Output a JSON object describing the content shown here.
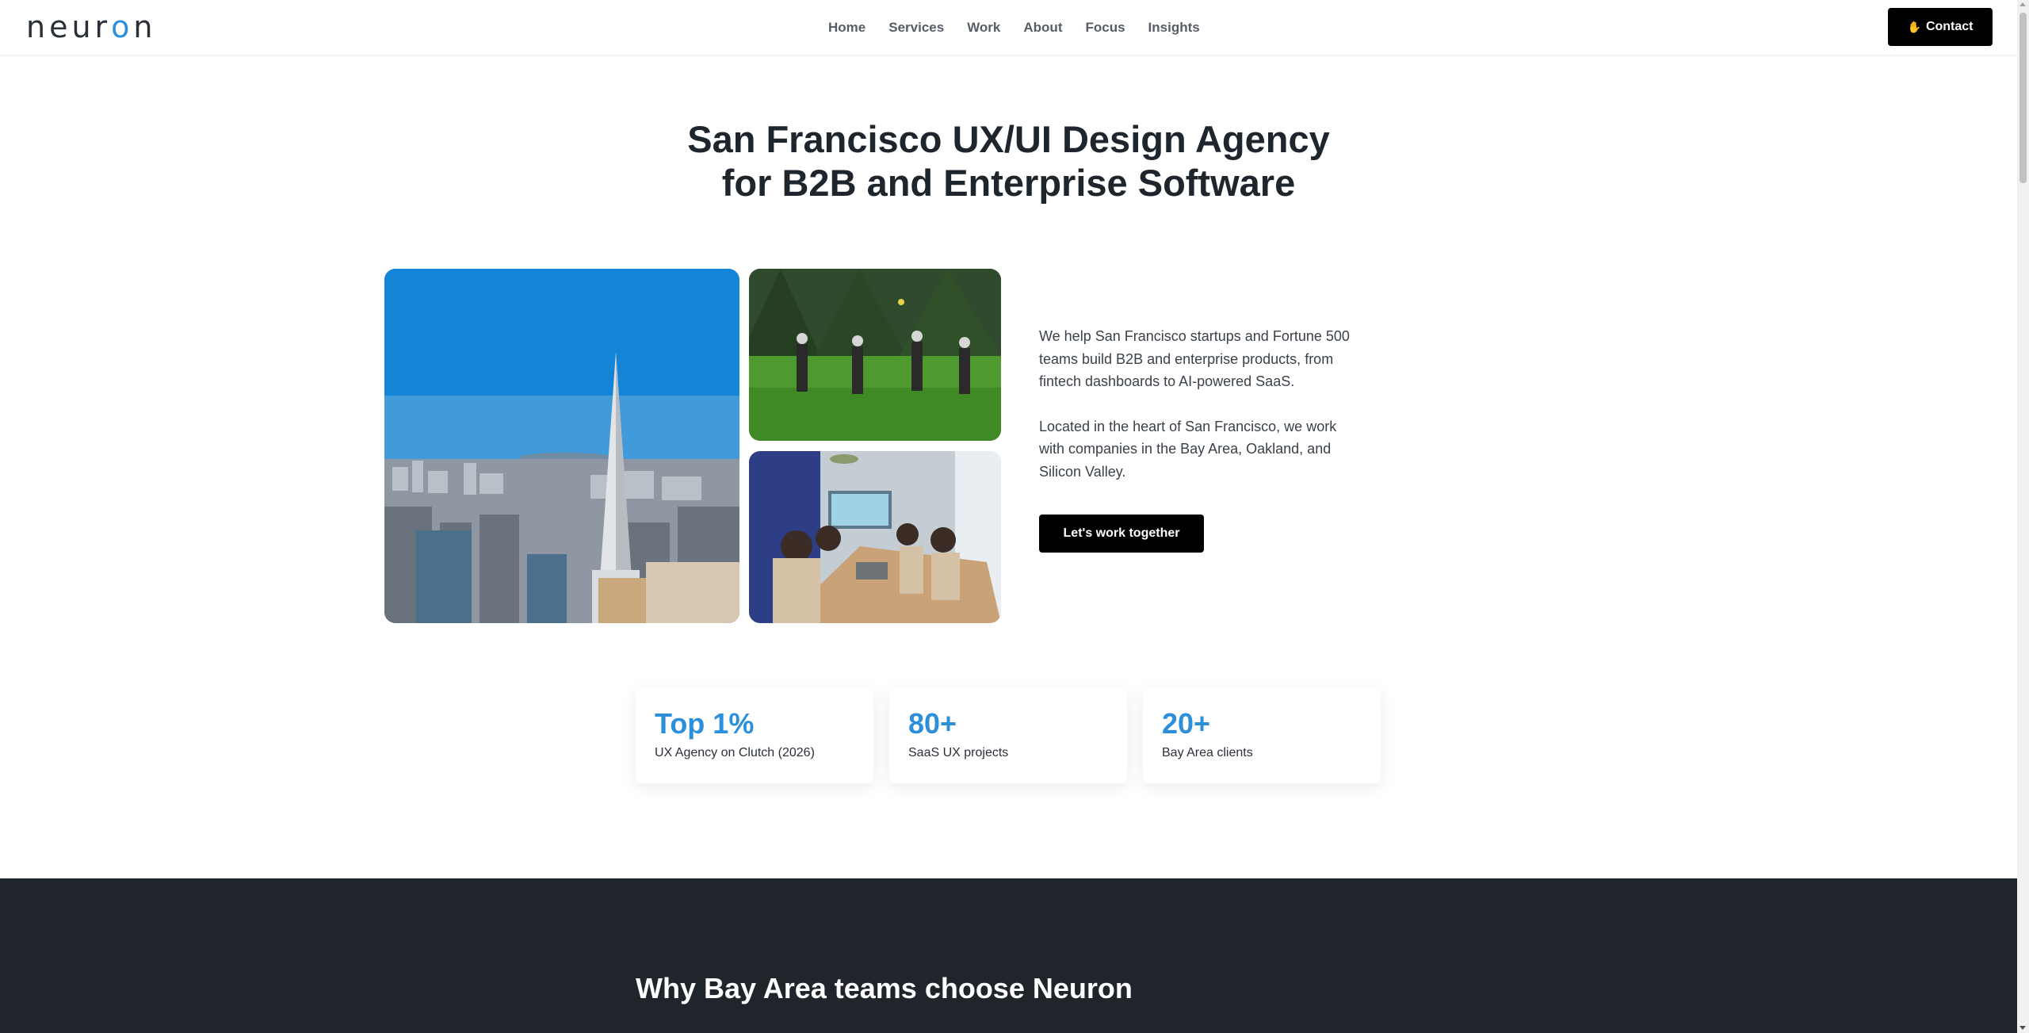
{
  "header": {
    "logo_text": "neuron",
    "nav": [
      "Home",
      "Services",
      "Work",
      "About",
      "Focus",
      "Insights"
    ],
    "contact_label": "Contact",
    "contact_icon": "waving-hand-icon"
  },
  "hero": {
    "title_line1": "San Francisco UX/UI Design Agency",
    "title_line2": "for B2B and Enterprise Software",
    "paragraph1": "We help San Francisco startups and Fortune 500 teams build B2B and enterprise products, from fintech dashboards to AI-powered SaaS.",
    "paragraph2": "Located in the heart of San Francisco, we work with companies in the Bay Area, Oakland, and Silicon Valley.",
    "cta_label": "Let's work together"
  },
  "stats": [
    {
      "number": "Top 1%",
      "label": "UX Agency on Clutch (2026)"
    },
    {
      "number": "80+",
      "label": "SaaS UX projects"
    },
    {
      "number": "20+",
      "label": "Bay Area clients"
    }
  ],
  "why_section": {
    "title": "Why Bay Area teams choose Neuron"
  },
  "colors": {
    "accent": "#2b8fdc",
    "dark_section": "#20252c",
    "button": "#000000"
  }
}
